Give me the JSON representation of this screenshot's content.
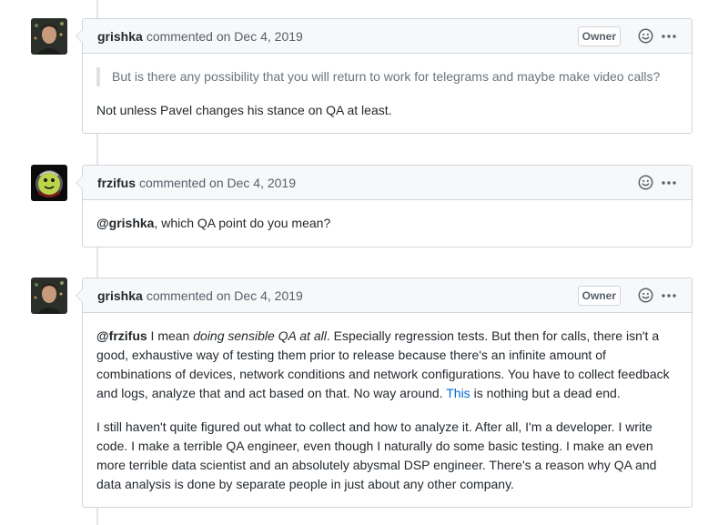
{
  "comments": [
    {
      "author": "grishka",
      "action": "commented on Dec 4, 2019",
      "badge": "Owner",
      "quote": "But is there any possibility that you will return to work for telegrams and maybe make video calls?",
      "paragraph": "Not unless Pavel changes his stance on QA at least."
    },
    {
      "author": "frzifus",
      "action": "commented on Dec 4, 2019",
      "mention": "@grishka",
      "text": ", which QA point do you mean?"
    },
    {
      "author": "grishka",
      "action": "commented on Dec 4, 2019",
      "badge": "Owner",
      "p1": {
        "mention": "@frzifus",
        "before_em": " I mean ",
        "em": "doing sensible QA at all",
        "after_em": ". Especially regression tests. But then for calls, there isn't a good, exhaustive way of testing them prior to release because there's an infinite amount of combinations of devices, network conditions and network configurations. You have to collect feedback and logs, analyze that and act based on that. No way around. ",
        "link": "This",
        "after_link": " is nothing but a dead end."
      },
      "p2": "I still haven't quite figured out what to collect and how to analyze it. After all, I'm a developer. I write code. I make a terrible QA engineer, even though I naturally do some basic testing. I make an even more terrible data scientist and an absolutely abysmal DSP engineer. There's a reason why QA and data analysis is done by separate people in just about any other company."
    }
  ],
  "icons": {
    "reaction": "smiley-icon",
    "more": "kebab-horizontal-icon"
  },
  "colors": {
    "link": "#0366d6",
    "border": "#d1d5da",
    "header_bg": "#f6f8fa"
  }
}
